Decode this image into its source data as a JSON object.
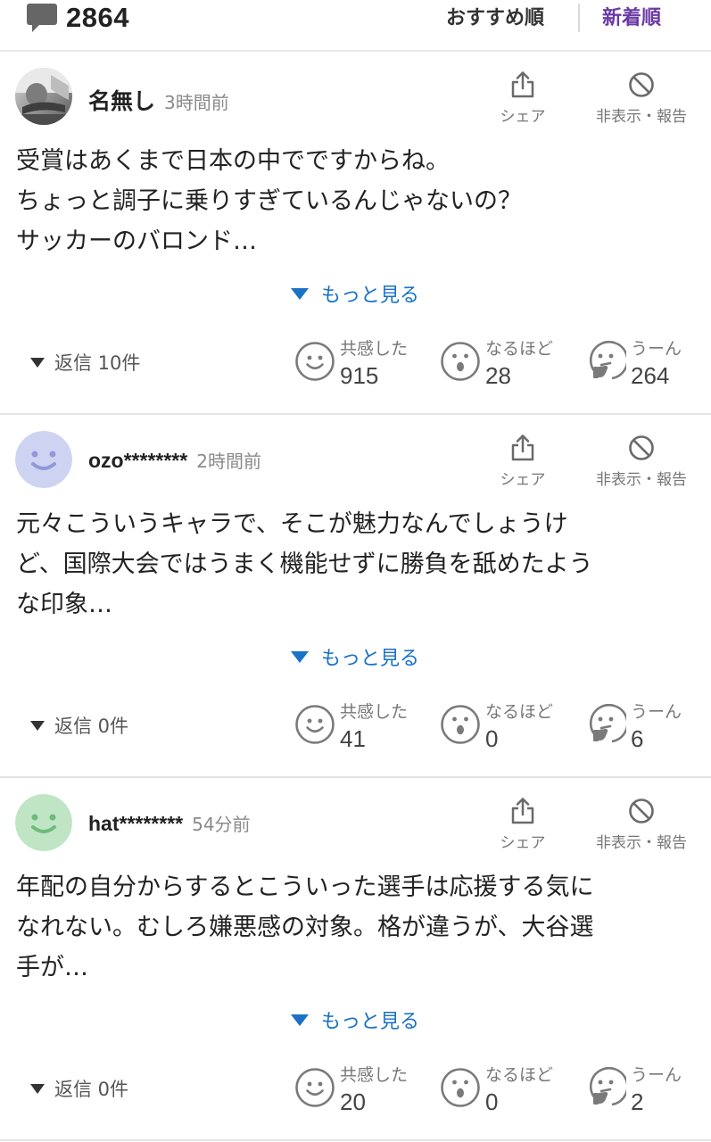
{
  "header": {
    "comment_icon": "speech-bubble-icon",
    "comment_count": "2864",
    "sort_recommended": "おすすめ順",
    "sort_newest": "新着順",
    "active_sort_color": "#6a3aa3"
  },
  "labels": {
    "share": "シェア",
    "hide_report": "非表示・報告",
    "more": "もっと見る",
    "react_empathy": "共感した",
    "react_naruhodo": "なるほど",
    "react_uun": "うーん"
  },
  "accent_color": "#1a72c6",
  "comments": [
    {
      "user": "名無し",
      "time": "3時間前",
      "avatar": "photo-avatar",
      "body": [
        "受賞はあくまで日本の中でですからね。",
        "ちょっと調子に乗りすぎているんじゃないの？",
        "サッカーのバロンド…"
      ],
      "replies": "返信 10件",
      "empathy": "915",
      "naruhodo": "28",
      "uun": "264"
    },
    {
      "user": "ozo********",
      "time": "2時間前",
      "avatar": "smiley-avatar-lavender",
      "avatar_color": "#cfd3f2",
      "body": [
        "元々こういうキャラで、そこが魅力なんでしょうけ",
        "ど、国際大会ではうまく機能せずに勝負を舐めたよう",
        "な印象…"
      ],
      "replies": "返信 0件",
      "empathy": "41",
      "naruhodo": "0",
      "uun": "6"
    },
    {
      "user": "hat********",
      "time": "54分前",
      "avatar": "smiley-avatar-green",
      "avatar_color": "#bfe5c4",
      "body": [
        "年配の自分からするとこういった選手は応援する気に",
        "なれない。むしろ嫌悪感の対象。格が違うが、大谷選",
        "手が…"
      ],
      "replies": "返信 0件",
      "empathy": "20",
      "naruhodo": "0",
      "uun": "2"
    }
  ]
}
